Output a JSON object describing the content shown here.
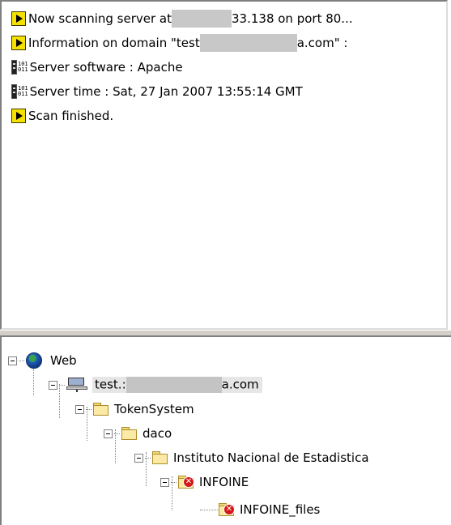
{
  "log": {
    "lines": [
      {
        "icon": "play-icon",
        "pre": "Now scanning server at",
        "post": "33.138 on port 80..."
      },
      {
        "icon": "play-icon",
        "pre": "Information on domain \"test",
        "post": "a.com\" :"
      },
      {
        "icon": "server-icon",
        "text": "Server software : Apache"
      },
      {
        "icon": "server-icon",
        "text": "Server time : Sat, 27 Jan 2007 13:55:14 GMT"
      },
      {
        "icon": "play-icon",
        "text": "Scan finished."
      }
    ]
  },
  "tree": {
    "root": "Web",
    "host_pre": "test.:",
    "host_post": "a.com",
    "folder1": "TokenSystem",
    "folder2": "daco",
    "folder3": "Instituto Nacional de Estadistica",
    "folder4": "INFOINE",
    "folder5": "INFOINE_files"
  },
  "colors": {
    "error_badge": "#d41818",
    "play_icon": "#f5e100"
  }
}
